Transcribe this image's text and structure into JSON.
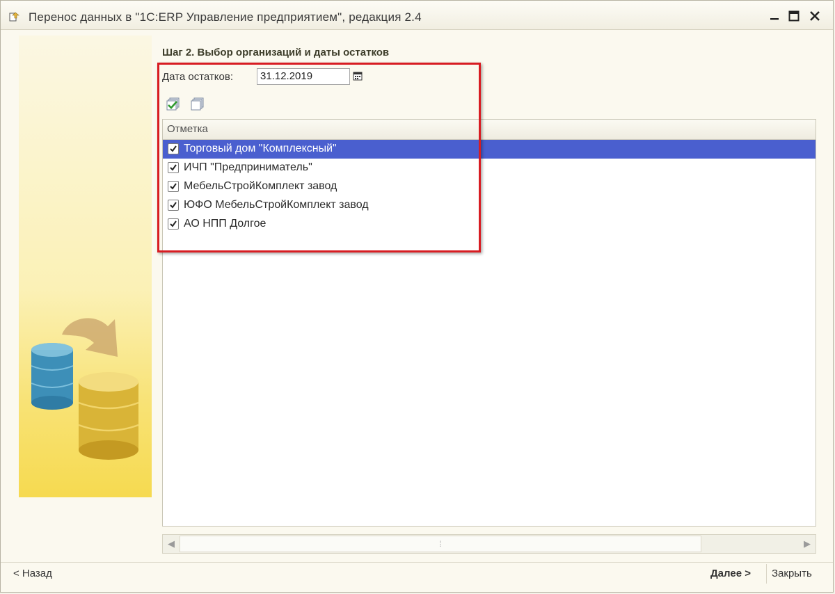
{
  "window": {
    "title": "Перенос данных в \"1С:ERP Управление предприятием\", редакция 2.4",
    "minimize_label": "—",
    "maximize_label": "☐",
    "close_label": "✕"
  },
  "step": {
    "title": "Шаг 2. Выбор организаций и даты остатков"
  },
  "date_field": {
    "label": "Дата остатков:",
    "value": "31.12.2019"
  },
  "toolbar": {
    "check_all_icon": "check-all-icon",
    "uncheck_all_icon": "uncheck-all-icon"
  },
  "grid": {
    "column_header": "Отметка",
    "rows": [
      {
        "label": "Торговый дом \"Комплексный\"",
        "checked": true,
        "selected": true
      },
      {
        "label": "ИЧП \"Предприниматель\"",
        "checked": true,
        "selected": false
      },
      {
        "label": "МебельСтройКомплект завод",
        "checked": true,
        "selected": false
      },
      {
        "label": "ЮФО МебельСтройКомплект завод",
        "checked": true,
        "selected": false
      },
      {
        "label": "АО НПП Долгое",
        "checked": true,
        "selected": false
      }
    ]
  },
  "footer": {
    "back_label": "< Назад",
    "next_label": "Далее >",
    "close_label": "Закрыть"
  },
  "colors": {
    "selection": "#4a5fcf",
    "highlight_frame": "#d81c22",
    "panel_yellow": "#f6da50"
  }
}
